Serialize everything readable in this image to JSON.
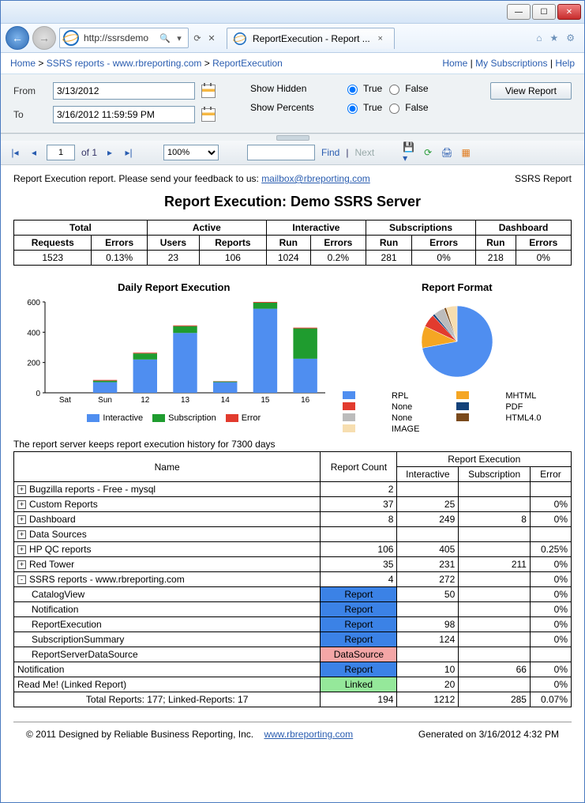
{
  "browser": {
    "url": "http://ssrsdemo",
    "tab_title": "ReportExecution - Report ...",
    "back_hint": "Back",
    "forward_hint": "Forward"
  },
  "breadcrumb": {
    "home": "Home",
    "folder": "SSRS reports - www.rbreporting.com",
    "report": "ReportExecution",
    "right_home": "Home",
    "subs": "My Subscriptions",
    "help": "Help"
  },
  "params": {
    "from_label": "From",
    "from_value": "3/13/2012",
    "to_label": "To",
    "to_value": "3/16/2012 11:59:59 PM",
    "show_hidden_label": "Show Hidden",
    "show_percents_label": "Show Percents",
    "true_label": "True",
    "false_label": "False",
    "show_hidden": "True",
    "show_percents": "True",
    "view_report": "View Report"
  },
  "toolbar": {
    "page_current": "1",
    "page_of": "of 1",
    "zoom": "100%",
    "find_placeholder": "",
    "find": "Find",
    "next": "Next"
  },
  "report": {
    "feedback_text": "Report Execution report. Please send your feedback to us: ",
    "feedback_email": "mailbox@rbreporting.com",
    "right_label": "SSRS Report",
    "title": "Report Execution: Demo SSRS Server"
  },
  "summary": {
    "groups": [
      "Total",
      "Active",
      "Interactive",
      "Subscriptions",
      "Dashboard"
    ],
    "cols": [
      "Requests",
      "Errors",
      "Users",
      "Reports",
      "Run",
      "Errors",
      "Run",
      "Errors",
      "Run",
      "Errors"
    ],
    "vals": [
      "1523",
      "0.13%",
      "23",
      "106",
      "1024",
      "0.2%",
      "281",
      "0%",
      "218",
      "0%"
    ]
  },
  "chart_data": [
    {
      "type": "bar",
      "title": "Daily Report Execution",
      "categories": [
        "Sat",
        "Sun",
        "12",
        "13",
        "14",
        "15",
        "16"
      ],
      "series": [
        {
          "name": "Interactive",
          "color": "#4f8ef0",
          "values": [
            0,
            70,
            220,
            395,
            70,
            555,
            225
          ]
        },
        {
          "name": "Subscription",
          "color": "#1f9c2f",
          "values": [
            0,
            10,
            40,
            45,
            5,
            40,
            200
          ]
        },
        {
          "name": "Error",
          "color": "#e23b2e",
          "values": [
            0,
            5,
            5,
            5,
            2,
            5,
            5
          ]
        }
      ],
      "ylim": [
        0,
        600
      ],
      "yticks": [
        0,
        200,
        400,
        600
      ],
      "xlabel": "",
      "ylabel": ""
    },
    {
      "type": "pie",
      "title": "Report Format",
      "slices": [
        {
          "name": "RPL",
          "color": "#4f8ef0",
          "value": 72
        },
        {
          "name": "MHTML",
          "color": "#f5a623",
          "value": 10
        },
        {
          "name": "None",
          "color": "#e23b2e",
          "value": 6
        },
        {
          "name": "PDF",
          "color": "#14427a",
          "value": 1
        },
        {
          "name": "None",
          "color": "#bcbcbc",
          "value": 5
        },
        {
          "name": "HTML4.0",
          "color": "#7a4a1c",
          "value": 1
        },
        {
          "name": "IMAGE",
          "color": "#f7deb0",
          "value": 5
        }
      ]
    }
  ],
  "history_note": "The report server keeps report execution history for 7300 days",
  "detail": {
    "headers": {
      "name": "Name",
      "count": "Report Count",
      "exec": "Report Execution",
      "interactive": "Interactive",
      "subscription": "Subscription",
      "error": "Error"
    },
    "rows": [
      {
        "exp": "+",
        "name": "Bugzilla reports - Free - mysql",
        "count": "2",
        "inter": "",
        "sub": "",
        "err": ""
      },
      {
        "exp": "+",
        "name": "Custom Reports",
        "count": "37",
        "inter": "25",
        "sub": "",
        "err": "0%"
      },
      {
        "exp": "+",
        "name": "Dashboard",
        "count": "8",
        "inter": "249",
        "sub": "8",
        "err": "0%"
      },
      {
        "exp": "+",
        "name": "Data Sources",
        "count": "",
        "inter": "",
        "sub": "",
        "err": ""
      },
      {
        "exp": "+",
        "name": "HP QC reports",
        "count": "106",
        "inter": "405",
        "sub": "",
        "err": "0.25%"
      },
      {
        "exp": "+",
        "name": "Red Tower",
        "count": "35",
        "inter": "231",
        "sub": "211",
        "err": "0%"
      },
      {
        "exp": "-",
        "name": "SSRS reports - www.rbreporting.com",
        "count": "4",
        "inter": "272",
        "sub": "",
        "err": "0%"
      },
      {
        "indent": true,
        "name": "CatalogView",
        "badge": "Report",
        "bclass": "badge-report",
        "inter": "50",
        "sub": "",
        "err": "0%"
      },
      {
        "indent": true,
        "name": "Notification",
        "badge": "Report",
        "bclass": "badge-report",
        "inter": "",
        "sub": "",
        "err": "0%"
      },
      {
        "indent": true,
        "name": "ReportExecution",
        "badge": "Report",
        "bclass": "badge-report",
        "inter": "98",
        "sub": "",
        "err": "0%"
      },
      {
        "indent": true,
        "name": "SubscriptionSummary",
        "badge": "Report",
        "bclass": "badge-report",
        "inter": "124",
        "sub": "",
        "err": "0%"
      },
      {
        "indent": true,
        "name": "ReportServerDataSource",
        "badge": "DataSource",
        "bclass": "badge-ds",
        "inter": "",
        "sub": "",
        "err": ""
      },
      {
        "exp": "",
        "name": "Notification",
        "badge": "Report",
        "bclass": "badge-report",
        "inter": "10",
        "sub": "66",
        "err": "0%"
      },
      {
        "exp": "",
        "name": "Read Me! (Linked Report)",
        "badge": "Linked",
        "bclass": "badge-linked",
        "inter": "20",
        "sub": "",
        "err": "0%"
      }
    ],
    "total_label": "Total Reports: 177; Linked-Reports: 17",
    "total": {
      "count": "194",
      "inter": "1212",
      "sub": "285",
      "err": "0.07%"
    }
  },
  "footer": {
    "copyright": "© 2011 Designed by Reliable Business Reporting, Inc.",
    "link": "www.rbreporting.com",
    "generated": "Generated on 3/16/2012 4:32 PM"
  }
}
